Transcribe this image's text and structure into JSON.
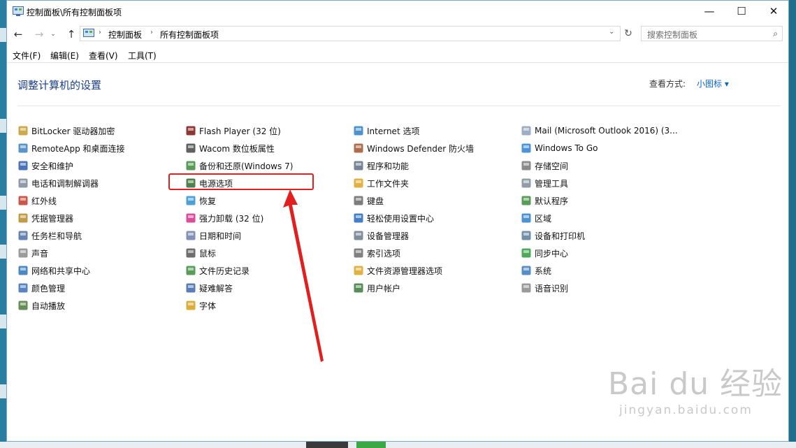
{
  "window": {
    "title": "控制面板\\所有控制面板项",
    "controls": {
      "minimize": "—",
      "maximize": "☐",
      "close": "✕"
    }
  },
  "nav": {
    "back": "←",
    "forward": "→",
    "recent": "⌄",
    "up": "↑",
    "breadcrumbs": [
      "控制面板",
      "所有控制面板项"
    ],
    "crumb_separator": "›",
    "address_dropdown": "⌄",
    "refresh": "↻",
    "search_placeholder": "搜索控制面板",
    "search_icon": "⌕"
  },
  "menu": [
    "文件(F)",
    "编辑(E)",
    "查看(V)",
    "工具(T)"
  ],
  "header": {
    "title": "调整计算机的设置",
    "view_by_label": "查看方式:",
    "view_by_value": "小图标 ▾"
  },
  "columns": [
    [
      {
        "label": "BitLocker 驱动器加密",
        "icon": "bitlocker-icon",
        "color": "#c49a2c"
      },
      {
        "label": "RemoteApp 和桌面连接",
        "icon": "remoteapp-icon",
        "color": "#3d7fc1"
      },
      {
        "label": "安全和维护",
        "icon": "flag-icon",
        "color": "#2d5aa8"
      },
      {
        "label": "电话和调制解调器",
        "icon": "modem-icon",
        "color": "#7b8a99"
      },
      {
        "label": "红外线",
        "icon": "infrared-icon",
        "color": "#c0392b"
      },
      {
        "label": "凭据管理器",
        "icon": "credential-icon",
        "color": "#b58a2a"
      },
      {
        "label": "任务栏和导航",
        "icon": "taskbar-icon",
        "color": "#4a6fa5"
      },
      {
        "label": "声音",
        "icon": "speaker-icon",
        "color": "#8a8a8a"
      },
      {
        "label": "网络和共享中心",
        "icon": "network-icon",
        "color": "#2e73b8"
      },
      {
        "label": "颜色管理",
        "icon": "color-management-icon",
        "color": "#3b6fb6"
      },
      {
        "label": "自动播放",
        "icon": "autoplay-icon",
        "color": "#4c7a3a"
      }
    ],
    [
      {
        "label": "Flash Player (32 位)",
        "icon": "flash-icon",
        "color": "#7a1410"
      },
      {
        "label": "Wacom 数位板属性",
        "icon": "wacom-icon",
        "color": "#444444"
      },
      {
        "label": "备份和还原(Windows 7)",
        "icon": "backup-icon",
        "color": "#3c8a3c"
      },
      {
        "label": "电源选项",
        "icon": "power-options-icon",
        "color": "#2e6b2e"
      },
      {
        "label": "恢复",
        "icon": "recovery-icon",
        "color": "#2f8fd0"
      },
      {
        "label": "强力卸载 (32 位)",
        "icon": "uninstall-icon",
        "color": "#d12f8a"
      },
      {
        "label": "日期和时间",
        "icon": "clock-icon",
        "color": "#6b7fa8"
      },
      {
        "label": "鼠标",
        "icon": "mouse-icon",
        "color": "#555555"
      },
      {
        "label": "文件历史记录",
        "icon": "file-history-icon",
        "color": "#3d8a3d"
      },
      {
        "label": "疑难解答",
        "icon": "troubleshoot-icon",
        "color": "#3e66a8"
      },
      {
        "label": "字体",
        "icon": "font-icon",
        "color": "#d4a017"
      }
    ],
    [
      {
        "label": "Internet 选项",
        "icon": "internet-icon",
        "color": "#2f7fc6"
      },
      {
        "label": "Windows Defender 防火墙",
        "icon": "firewall-icon",
        "color": "#a0522d"
      },
      {
        "label": "程序和功能",
        "icon": "programs-icon",
        "color": "#5f6f80"
      },
      {
        "label": "工作文件夹",
        "icon": "work-folders-icon",
        "color": "#d9a521"
      },
      {
        "label": "键盘",
        "icon": "keyboard-icon",
        "color": "#666666"
      },
      {
        "label": "轻松使用设置中心",
        "icon": "ease-of-access-icon",
        "color": "#2567b8"
      },
      {
        "label": "设备管理器",
        "icon": "device-manager-icon",
        "color": "#6a7a8a"
      },
      {
        "label": "索引选项",
        "icon": "indexing-icon",
        "color": "#6b6b6b"
      },
      {
        "label": "文件资源管理器选项",
        "icon": "folder-options-icon",
        "color": "#d9a521"
      },
      {
        "label": "用户帐户",
        "icon": "user-accounts-icon",
        "color": "#3a7a3a"
      }
    ],
    [
      {
        "label": "Mail (Microsoft Outlook 2016) (3...",
        "icon": "mail-icon",
        "color": "#8aa0b8"
      },
      {
        "label": "Windows To Go",
        "icon": "windows-to-go-icon",
        "color": "#2f7fd0"
      },
      {
        "label": "存储空间",
        "icon": "storage-icon",
        "color": "#777777"
      },
      {
        "label": "管理工具",
        "icon": "admin-tools-icon",
        "color": "#7f8c99"
      },
      {
        "label": "默认程序",
        "icon": "default-programs-icon",
        "color": "#3c8a3c"
      },
      {
        "label": "区域",
        "icon": "region-icon",
        "color": "#2f7fc6"
      },
      {
        "label": "设备和打印机",
        "icon": "devices-printers-icon",
        "color": "#5a7a9a"
      },
      {
        "label": "同步中心",
        "icon": "sync-icon",
        "color": "#2e9a3e"
      },
      {
        "label": "系统",
        "icon": "system-icon",
        "color": "#3a7ab8"
      },
      {
        "label": "语音识别",
        "icon": "microphone-icon",
        "color": "#888888"
      }
    ]
  ],
  "annotation": {
    "highlight_color": "#e21f1f"
  },
  "watermark": {
    "main": "Bai du 经验",
    "sub": "jingyan.baidu.com"
  }
}
